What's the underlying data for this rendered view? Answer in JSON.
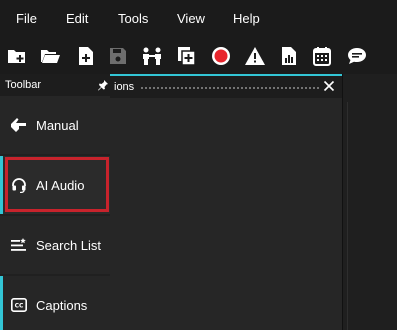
{
  "menu": {
    "file": "File",
    "edit": "Edit",
    "tools": "Tools",
    "view": "View",
    "help": "Help"
  },
  "toolbar_icons": [
    "new-folder-icon",
    "open-folder-icon",
    "new-file-icon",
    "save-icon",
    "people-icon",
    "copy-add-icon",
    "record-icon",
    "warning-icon",
    "report-icon",
    "calendar-icon",
    "chat-icon"
  ],
  "sidebar": {
    "title": "Toolbar",
    "items": [
      {
        "label": "Manual",
        "icon": "hand-pointer-icon"
      },
      {
        "label": "AI Audio",
        "icon": "headset-icon"
      },
      {
        "label": "Search List",
        "icon": "search-list-icon"
      },
      {
        "label": "Captions",
        "icon": "captions-icon"
      }
    ]
  },
  "panel": {
    "title": "ions"
  },
  "colors": {
    "accent": "#33c6d6",
    "highlight": "#c8232c",
    "record": "#e8252c"
  }
}
